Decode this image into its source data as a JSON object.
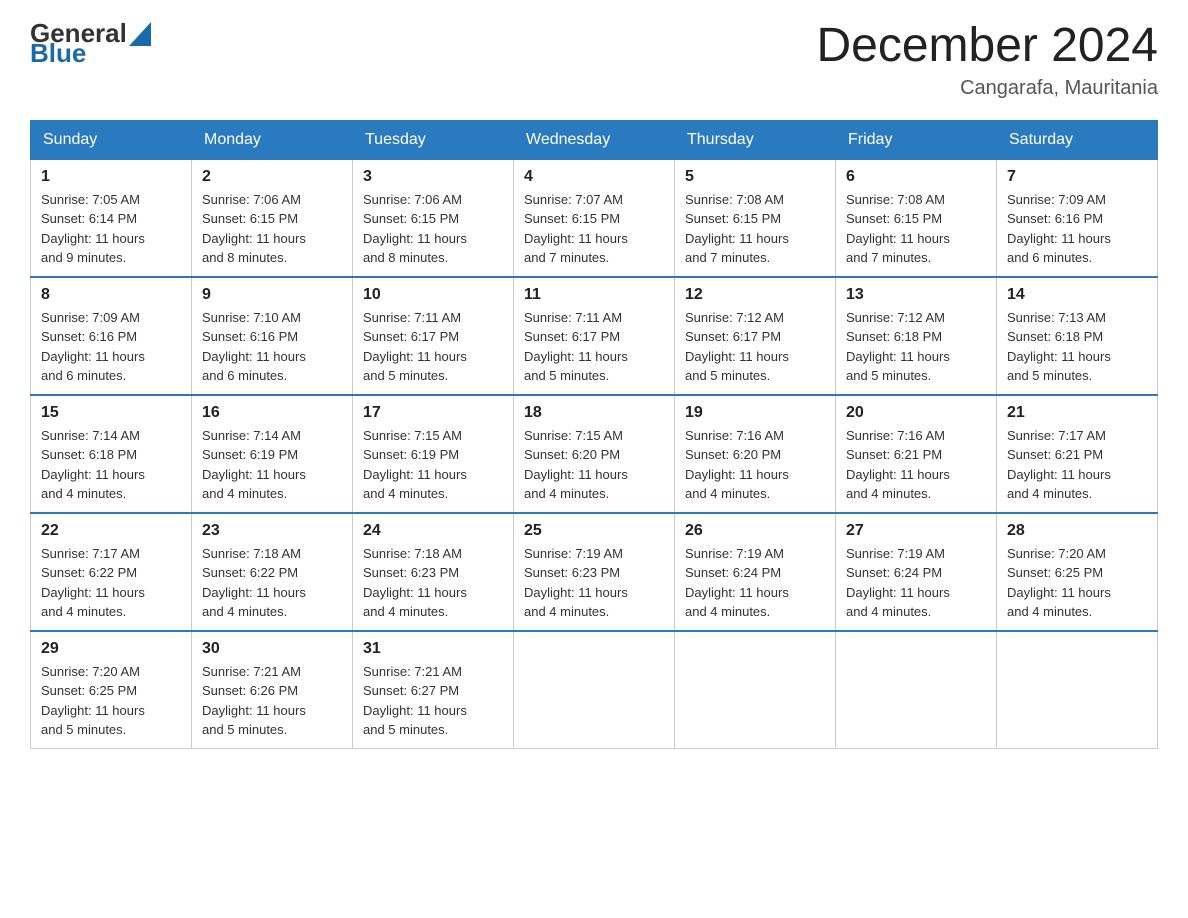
{
  "header": {
    "logo_general": "General",
    "logo_blue": "Blue",
    "month_year": "December 2024",
    "location": "Cangarafa, Mauritania"
  },
  "weekdays": [
    "Sunday",
    "Monday",
    "Tuesday",
    "Wednesday",
    "Thursday",
    "Friday",
    "Saturday"
  ],
  "weeks": [
    [
      {
        "day": "1",
        "sunrise": "7:05 AM",
        "sunset": "6:14 PM",
        "daylight": "11 hours and 9 minutes."
      },
      {
        "day": "2",
        "sunrise": "7:06 AM",
        "sunset": "6:15 PM",
        "daylight": "11 hours and 8 minutes."
      },
      {
        "day": "3",
        "sunrise": "7:06 AM",
        "sunset": "6:15 PM",
        "daylight": "11 hours and 8 minutes."
      },
      {
        "day": "4",
        "sunrise": "7:07 AM",
        "sunset": "6:15 PM",
        "daylight": "11 hours and 7 minutes."
      },
      {
        "day": "5",
        "sunrise": "7:08 AM",
        "sunset": "6:15 PM",
        "daylight": "11 hours and 7 minutes."
      },
      {
        "day": "6",
        "sunrise": "7:08 AM",
        "sunset": "6:15 PM",
        "daylight": "11 hours and 7 minutes."
      },
      {
        "day": "7",
        "sunrise": "7:09 AM",
        "sunset": "6:16 PM",
        "daylight": "11 hours and 6 minutes."
      }
    ],
    [
      {
        "day": "8",
        "sunrise": "7:09 AM",
        "sunset": "6:16 PM",
        "daylight": "11 hours and 6 minutes."
      },
      {
        "day": "9",
        "sunrise": "7:10 AM",
        "sunset": "6:16 PM",
        "daylight": "11 hours and 6 minutes."
      },
      {
        "day": "10",
        "sunrise": "7:11 AM",
        "sunset": "6:17 PM",
        "daylight": "11 hours and 5 minutes."
      },
      {
        "day": "11",
        "sunrise": "7:11 AM",
        "sunset": "6:17 PM",
        "daylight": "11 hours and 5 minutes."
      },
      {
        "day": "12",
        "sunrise": "7:12 AM",
        "sunset": "6:17 PM",
        "daylight": "11 hours and 5 minutes."
      },
      {
        "day": "13",
        "sunrise": "7:12 AM",
        "sunset": "6:18 PM",
        "daylight": "11 hours and 5 minutes."
      },
      {
        "day": "14",
        "sunrise": "7:13 AM",
        "sunset": "6:18 PM",
        "daylight": "11 hours and 5 minutes."
      }
    ],
    [
      {
        "day": "15",
        "sunrise": "7:14 AM",
        "sunset": "6:18 PM",
        "daylight": "11 hours and 4 minutes."
      },
      {
        "day": "16",
        "sunrise": "7:14 AM",
        "sunset": "6:19 PM",
        "daylight": "11 hours and 4 minutes."
      },
      {
        "day": "17",
        "sunrise": "7:15 AM",
        "sunset": "6:19 PM",
        "daylight": "11 hours and 4 minutes."
      },
      {
        "day": "18",
        "sunrise": "7:15 AM",
        "sunset": "6:20 PM",
        "daylight": "11 hours and 4 minutes."
      },
      {
        "day": "19",
        "sunrise": "7:16 AM",
        "sunset": "6:20 PM",
        "daylight": "11 hours and 4 minutes."
      },
      {
        "day": "20",
        "sunrise": "7:16 AM",
        "sunset": "6:21 PM",
        "daylight": "11 hours and 4 minutes."
      },
      {
        "day": "21",
        "sunrise": "7:17 AM",
        "sunset": "6:21 PM",
        "daylight": "11 hours and 4 minutes."
      }
    ],
    [
      {
        "day": "22",
        "sunrise": "7:17 AM",
        "sunset": "6:22 PM",
        "daylight": "11 hours and 4 minutes."
      },
      {
        "day": "23",
        "sunrise": "7:18 AM",
        "sunset": "6:22 PM",
        "daylight": "11 hours and 4 minutes."
      },
      {
        "day": "24",
        "sunrise": "7:18 AM",
        "sunset": "6:23 PM",
        "daylight": "11 hours and 4 minutes."
      },
      {
        "day": "25",
        "sunrise": "7:19 AM",
        "sunset": "6:23 PM",
        "daylight": "11 hours and 4 minutes."
      },
      {
        "day": "26",
        "sunrise": "7:19 AM",
        "sunset": "6:24 PM",
        "daylight": "11 hours and 4 minutes."
      },
      {
        "day": "27",
        "sunrise": "7:19 AM",
        "sunset": "6:24 PM",
        "daylight": "11 hours and 4 minutes."
      },
      {
        "day": "28",
        "sunrise": "7:20 AM",
        "sunset": "6:25 PM",
        "daylight": "11 hours and 4 minutes."
      }
    ],
    [
      {
        "day": "29",
        "sunrise": "7:20 AM",
        "sunset": "6:25 PM",
        "daylight": "11 hours and 5 minutes."
      },
      {
        "day": "30",
        "sunrise": "7:21 AM",
        "sunset": "6:26 PM",
        "daylight": "11 hours and 5 minutes."
      },
      {
        "day": "31",
        "sunrise": "7:21 AM",
        "sunset": "6:27 PM",
        "daylight": "11 hours and 5 minutes."
      },
      null,
      null,
      null,
      null
    ]
  ],
  "labels": {
    "sunrise": "Sunrise:",
    "sunset": "Sunset:",
    "daylight": "Daylight:"
  }
}
